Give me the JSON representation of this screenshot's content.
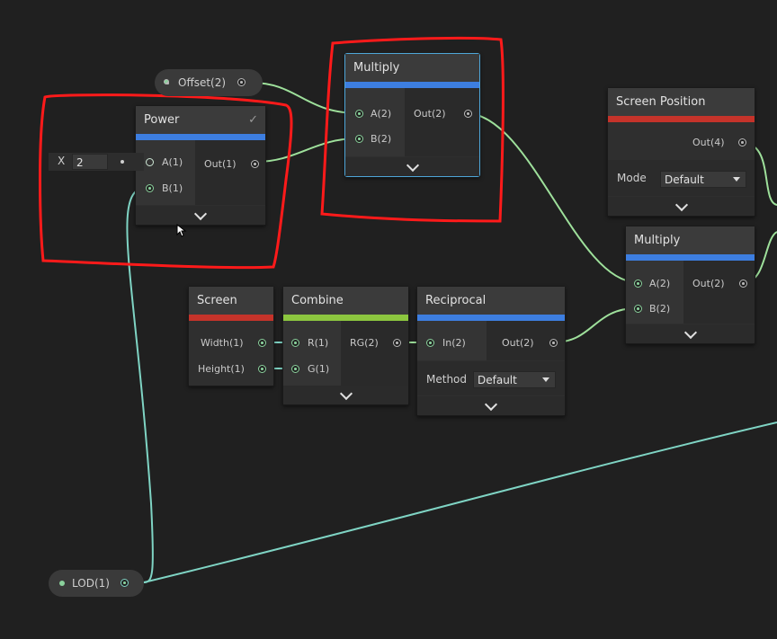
{
  "colors": {
    "background": "#202020",
    "node_body": "#2f2f2f",
    "header_blue": "#3d7ee0",
    "header_red": "#c5332a",
    "header_green": "#8cc63f",
    "wire_vec1": "#7fd4c4",
    "wire_vec2": "#9ee09b",
    "selection": "#4ea6d8",
    "annotation_red": "#ff1a1a"
  },
  "offset_property": {
    "label": "Offset(2)"
  },
  "lod_property": {
    "label": "LOD(1)"
  },
  "power_node": {
    "title": "Power",
    "check_icon": "checkmark-icon",
    "inputs": [
      "A(1)",
      "B(1)"
    ],
    "outputs": [
      "Out(1)"
    ],
    "inline_x": {
      "axis": "X",
      "value": "2"
    }
  },
  "multiply_top": {
    "title": "Multiply",
    "inputs": [
      "A(2)",
      "B(2)"
    ],
    "outputs": [
      "Out(2)"
    ]
  },
  "screen_position": {
    "title": "Screen Position",
    "outputs": [
      "Out(4)"
    ],
    "mode_label": "Mode",
    "mode_value": "Default"
  },
  "multiply_right": {
    "title": "Multiply",
    "inputs": [
      "A(2)",
      "B(2)"
    ],
    "outputs": [
      "Out(2)"
    ]
  },
  "screen_node": {
    "title": "Screen",
    "outputs": [
      "Width(1)",
      "Height(1)"
    ]
  },
  "combine_node": {
    "title": "Combine",
    "inputs": [
      "R(1)",
      "G(1)"
    ],
    "outputs": [
      "RG(2)"
    ]
  },
  "reciprocal_node": {
    "title": "Reciprocal",
    "inputs": [
      "In(2)"
    ],
    "outputs": [
      "Out(2)"
    ],
    "method_label": "Method",
    "method_value": "Default"
  }
}
